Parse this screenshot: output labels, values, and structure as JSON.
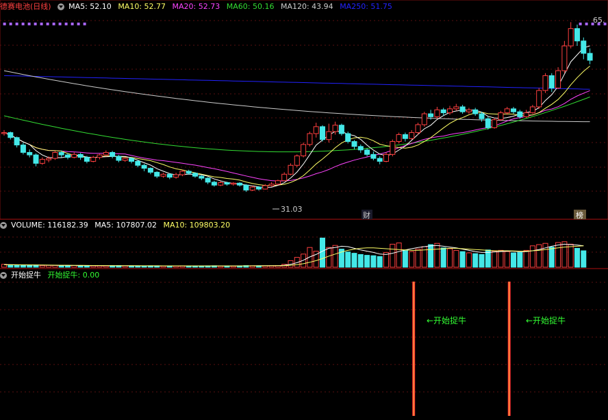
{
  "colors": {
    "ma5": "#ffffff",
    "ma10": "#ffff66",
    "ma20": "#ff44ff",
    "ma60": "#33dd33",
    "ma120": "#cccccc",
    "ma250": "#2222ff",
    "up": "#ff4040",
    "down": "#44e8e8",
    "signal": "#ff3030",
    "label_green": "#33ff33"
  },
  "price_panel": {
    "name": "德赛电池",
    "period": "(日线)",
    "ma5": "MA5: 52.10",
    "ma10": "MA10: 52.77",
    "ma20": "MA20: 52.73",
    "ma60": "MA60: 50.16",
    "ma120": "MA120: 43.94",
    "ma250": "MA250: 51.75",
    "high_label": "65.",
    "low_label": "31.03",
    "marker_cai": "财",
    "marker_bang": "榜"
  },
  "volume_panel": {
    "volume": "VOLUME: 116182.39",
    "ma5": "MA5: 107807.02",
    "ma10": "MA10: 109803.20"
  },
  "indicator_panel": {
    "name": "开始捉牛",
    "value": "开始捉牛: 0.00",
    "signal_label": "←开始捉牛"
  },
  "chart_data": {
    "type": "candlestick",
    "candles": [
      [
        42.8,
        43.0,
        43.5,
        42.4
      ],
      [
        43.0,
        42.0,
        43.2,
        41.6
      ],
      [
        42.0,
        40.5,
        42.2,
        40.0
      ],
      [
        40.5,
        39.0,
        41.0,
        38.6
      ],
      [
        39.0,
        38.5,
        39.6,
        38.0
      ],
      [
        38.5,
        36.8,
        38.8,
        36.2
      ],
      [
        36.8,
        37.6,
        38.0,
        36.5
      ],
      [
        37.5,
        37.8,
        38.2,
        37.0
      ],
      [
        37.8,
        39.0,
        39.3,
        37.5
      ],
      [
        39.0,
        38.5,
        39.4,
        38.0
      ],
      [
        38.5,
        38.0,
        38.8,
        37.6
      ],
      [
        38.0,
        38.6,
        39.0,
        37.8
      ],
      [
        38.6,
        38.0,
        38.9,
        37.5
      ],
      [
        38.0,
        37.2,
        38.3,
        36.8
      ],
      [
        37.2,
        38.0,
        38.3,
        37.0
      ],
      [
        38.0,
        38.5,
        38.7,
        37.6
      ],
      [
        38.5,
        39.0,
        39.4,
        38.2
      ],
      [
        39.0,
        38.2,
        39.3,
        37.8
      ],
      [
        38.2,
        37.4,
        38.5,
        37.0
      ],
      [
        37.4,
        37.8,
        38.1,
        37.1
      ],
      [
        37.8,
        37.2,
        38.0,
        36.8
      ],
      [
        37.2,
        36.4,
        37.5,
        36.0
      ],
      [
        36.4,
        35.8,
        36.7,
        35.2
      ],
      [
        35.8,
        35.0,
        36.0,
        34.6
      ],
      [
        35.0,
        34.2,
        35.2,
        33.8
      ],
      [
        34.2,
        34.6,
        34.9,
        33.9
      ],
      [
        34.6,
        34.0,
        34.8,
        33.6
      ],
      [
        34.0,
        34.5,
        34.9,
        33.7
      ],
      [
        34.5,
        35.2,
        35.5,
        34.2
      ],
      [
        35.2,
        34.8,
        35.5,
        34.5
      ],
      [
        34.8,
        34.2,
        35.0,
        33.9
      ],
      [
        34.2,
        33.8,
        34.5,
        33.4
      ],
      [
        33.8,
        33.0,
        34.0,
        32.6
      ],
      [
        33.0,
        32.4,
        33.3,
        32.1
      ],
      [
        32.4,
        32.9,
        33.2,
        32.2
      ],
      [
        32.9,
        32.6,
        33.1,
        32.3
      ],
      [
        32.6,
        32.8,
        33.0,
        32.3
      ],
      [
        32.8,
        32.4,
        33.0,
        32.1
      ],
      [
        32.4,
        31.4,
        32.6,
        31.03
      ],
      [
        31.4,
        32.0,
        32.3,
        31.2
      ],
      [
        32.0,
        31.6,
        32.2,
        31.3
      ],
      [
        31.6,
        32.3,
        32.6,
        31.5
      ],
      [
        32.3,
        32.6,
        33.0,
        32.1
      ],
      [
        32.6,
        33.3,
        33.5,
        32.4
      ],
      [
        33.3,
        34.6,
        35.0,
        33.2
      ],
      [
        34.6,
        36.4,
        36.8,
        34.4
      ],
      [
        36.4,
        38.3,
        38.6,
        36.0
      ],
      [
        38.3,
        40.6,
        41.0,
        38.0
      ],
      [
        40.6,
        42.8,
        43.2,
        40.2
      ],
      [
        42.8,
        44.2,
        45.0,
        42.0
      ],
      [
        44.2,
        41.6,
        44.5,
        41.2
      ],
      [
        41.6,
        43.2,
        44.8,
        41.0
      ],
      [
        43.2,
        44.5,
        45.2,
        42.6
      ],
      [
        44.5,
        42.8,
        44.8,
        42.4
      ],
      [
        42.8,
        41.2,
        43.2,
        40.8
      ],
      [
        41.2,
        40.2,
        41.5,
        39.6
      ],
      [
        40.2,
        39.5,
        40.6,
        38.9
      ],
      [
        39.5,
        38.6,
        39.8,
        38.2
      ],
      [
        38.6,
        37.8,
        39.2,
        37.4
      ],
      [
        37.8,
        37.2,
        38.2,
        36.6
      ],
      [
        37.2,
        38.6,
        39.0,
        37.0
      ],
      [
        38.6,
        41.2,
        41.6,
        38.2
      ],
      [
        41.2,
        42.6,
        43.0,
        40.8
      ],
      [
        42.6,
        41.8,
        43.0,
        41.2
      ],
      [
        41.8,
        43.0,
        43.5,
        41.6
      ],
      [
        43.0,
        44.6,
        45.0,
        42.6
      ],
      [
        44.6,
        46.8,
        47.2,
        44.2
      ],
      [
        46.8,
        46.2,
        47.6,
        45.6
      ],
      [
        46.2,
        47.6,
        48.2,
        45.8
      ],
      [
        47.6,
        47.0,
        48.0,
        46.4
      ],
      [
        47.0,
        47.8,
        48.4,
        46.6
      ],
      [
        47.8,
        48.2,
        48.8,
        47.4
      ],
      [
        48.2,
        47.2,
        48.6,
        46.8
      ],
      [
        47.2,
        47.6,
        48.0,
        46.8
      ],
      [
        47.6,
        46.8,
        48.0,
        46.4
      ],
      [
        46.8,
        45.8,
        47.2,
        45.2
      ],
      [
        45.8,
        44.0,
        46.2,
        43.6
      ],
      [
        44.0,
        45.6,
        46.0,
        43.8
      ],
      [
        45.6,
        47.0,
        47.4,
        45.4
      ],
      [
        47.0,
        47.8,
        48.2,
        46.6
      ],
      [
        47.8,
        47.2,
        48.2,
        46.8
      ],
      [
        47.2,
        46.2,
        47.6,
        45.8
      ],
      [
        46.2,
        47.0,
        47.6,
        46.0
      ],
      [
        47.0,
        48.2,
        48.6,
        46.8
      ],
      [
        48.2,
        51.5,
        52.0,
        47.8
      ],
      [
        51.5,
        54.5,
        55.0,
        51.0
      ],
      [
        54.5,
        52.0,
        55.0,
        51.2
      ],
      [
        52.0,
        55.5,
        56.2,
        51.8
      ],
      [
        55.5,
        60.5,
        61.5,
        55.0
      ],
      [
        60.5,
        64.0,
        65.3,
        60.0
      ],
      [
        64.0,
        61.5,
        64.8,
        60.5
      ],
      [
        61.5,
        59.0,
        62.2,
        57.8
      ],
      [
        59.0,
        57.6,
        60.0,
        56.8
      ]
    ],
    "volume_max": 180000,
    "volume": [
      14000,
      12000,
      11000,
      10000,
      9500,
      10500,
      8000,
      9000,
      8500,
      8000,
      7500,
      8200,
      7800,
      7200,
      6800,
      7000,
      6500,
      7200,
      7800,
      6900,
      6200,
      6000,
      6500,
      7000,
      6800,
      6200,
      5800,
      6400,
      7000,
      6600,
      6200,
      5800,
      6800,
      7200,
      6600,
      6400,
      6000,
      6800,
      8000,
      7400,
      6800,
      7200,
      7800,
      8400,
      14000,
      32000,
      48000,
      64000,
      96000,
      78000,
      142000,
      96000,
      106000,
      88000,
      74000,
      68000,
      62000,
      58000,
      56000,
      52000,
      72000,
      112000,
      118000,
      80000,
      76000,
      88000,
      100000,
      110000,
      116000,
      94000,
      90000,
      82000,
      76000,
      70000,
      66000,
      62000,
      84000,
      78000,
      82000,
      76000,
      70000,
      72000,
      82000,
      104000,
      110000,
      116000,
      98000,
      120000,
      124000,
      112000,
      92000,
      80000
    ],
    "vol_ma5": [
      13000,
      12500,
      12000,
      11500,
      11000,
      10500,
      10000,
      9500,
      9000,
      8800,
      8500,
      8300,
      8100,
      7900,
      7700,
      7500,
      7300,
      7200,
      7100,
      7000,
      6900,
      6700,
      6600,
      6500,
      6500,
      6400,
      6400,
      6300,
      6400,
      6500,
      6400,
      6300,
      6300,
      6400,
      6500,
      6500,
      6400,
      6500,
      6800,
      7000,
      7200,
      7300,
      7400,
      7600,
      9000,
      14000,
      22000,
      34000,
      50000,
      62000,
      78000,
      92000,
      96000,
      102000,
      100000,
      92000,
      84000,
      78000,
      72000,
      64000,
      62000,
      68000,
      76000,
      84000,
      90000,
      96000,
      100000,
      104000,
      106000,
      102000,
      98000,
      94000,
      88000,
      82000,
      76000,
      72000,
      72000,
      74000,
      76000,
      78000,
      78000,
      76000,
      76000,
      80000,
      86000,
      94000,
      102000,
      108000,
      112000,
      110000,
      108000,
      104000
    ],
    "vol_ma10": [
      12000,
      11800,
      11600,
      11400,
      11200,
      11000,
      10700,
      10400,
      10100,
      9800,
      9500,
      9200,
      8900,
      8600,
      8400,
      8200,
      8000,
      7800,
      7600,
      7400,
      7300,
      7200,
      7100,
      7000,
      6900,
      6800,
      6700,
      6600,
      6600,
      6600,
      6500,
      6500,
      6500,
      6500,
      6500,
      6500,
      6500,
      6500,
      6600,
      6700,
      6800,
      6900,
      7000,
      7200,
      7800,
      9500,
      12500,
      17000,
      24000,
      32000,
      42000,
      54000,
      64000,
      74000,
      82000,
      88000,
      92000,
      94000,
      94000,
      92000,
      90000,
      88000,
      86000,
      84000,
      82000,
      82000,
      84000,
      86000,
      88000,
      90000,
      92000,
      92000,
      90000,
      88000,
      86000,
      84000,
      82000,
      80000,
      80000,
      80000,
      79000,
      78000,
      78000,
      80000,
      82000,
      86000,
      90000,
      94000,
      98000,
      100000,
      102000,
      104000
    ],
    "signals": [
      64,
      79
    ]
  }
}
